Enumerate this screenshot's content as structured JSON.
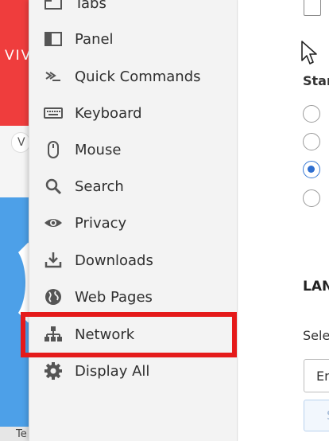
{
  "background": {
    "brand_text": "VIVA",
    "tab_letter": "V",
    "bottom_text": "Te",
    "colors": {
      "red": "#ef3d3d",
      "blue": "#4da0e8"
    }
  },
  "sidebar": {
    "items": [
      {
        "label": "Tabs",
        "icon": "tabs-icon"
      },
      {
        "label": "Panel",
        "icon": "panel-icon"
      },
      {
        "label": "Quick Commands",
        "icon": "quick-commands-icon"
      },
      {
        "label": "Keyboard",
        "icon": "keyboard-icon"
      },
      {
        "label": "Mouse",
        "icon": "mouse-icon"
      },
      {
        "label": "Search",
        "icon": "search-icon"
      },
      {
        "label": "Privacy",
        "icon": "eye-icon"
      },
      {
        "label": "Downloads",
        "icon": "download-icon"
      },
      {
        "label": "Web Pages",
        "icon": "globe-icon"
      },
      {
        "label": "Network",
        "icon": "network-icon"
      },
      {
        "label": "Display All",
        "icon": "gear-icon"
      }
    ],
    "highlighted_item": "Network",
    "highlight_color": "#e51a1a"
  },
  "content": {
    "startup_label": "Star",
    "language_heading": "LAN",
    "select_label": "Sele",
    "language_select_value": "En",
    "language_button_label": "S",
    "accent_color": "#2f6fd0"
  }
}
